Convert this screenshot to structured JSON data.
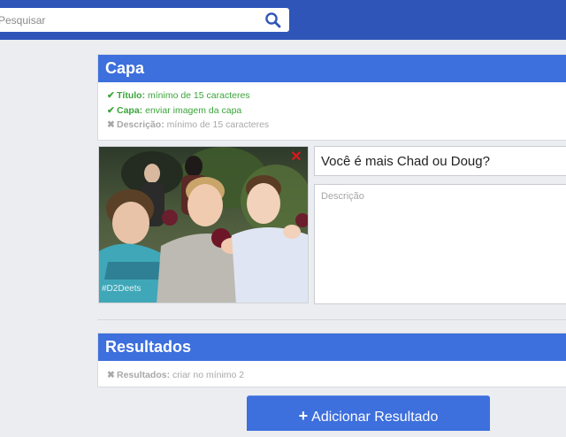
{
  "search": {
    "placeholder": "Pesquisar"
  },
  "cover_section": {
    "title": "Capa",
    "requirements": [
      {
        "status": "ok",
        "label": "Título:",
        "text": "mínimo de 15 caracteres"
      },
      {
        "status": "ok",
        "label": "Capa:",
        "text": "enviar imagem da capa"
      },
      {
        "status": "missing",
        "label": "Descrição:",
        "text": "mínimo de 15 caracteres"
      }
    ],
    "image_caption": "#D2Deets",
    "title_value": "Você é mais Chad ou Doug?",
    "description_placeholder": "Descrição"
  },
  "results_section": {
    "title": "Resultados",
    "requirements": [
      {
        "status": "missing",
        "label": "Resultados:",
        "text": "criar no mínimo 2"
      }
    ]
  },
  "add_result_button": {
    "label": "Adicionar Resultado"
  },
  "colors": {
    "topbar": "#2f55b8",
    "section_header": "#3d6fdd",
    "ok": "#3aa53a",
    "missing": "#a8a8a8",
    "remove": "#e0141c"
  },
  "icons": [
    "search-icon",
    "check-icon",
    "cross-icon",
    "close-icon",
    "plus-icon"
  ]
}
